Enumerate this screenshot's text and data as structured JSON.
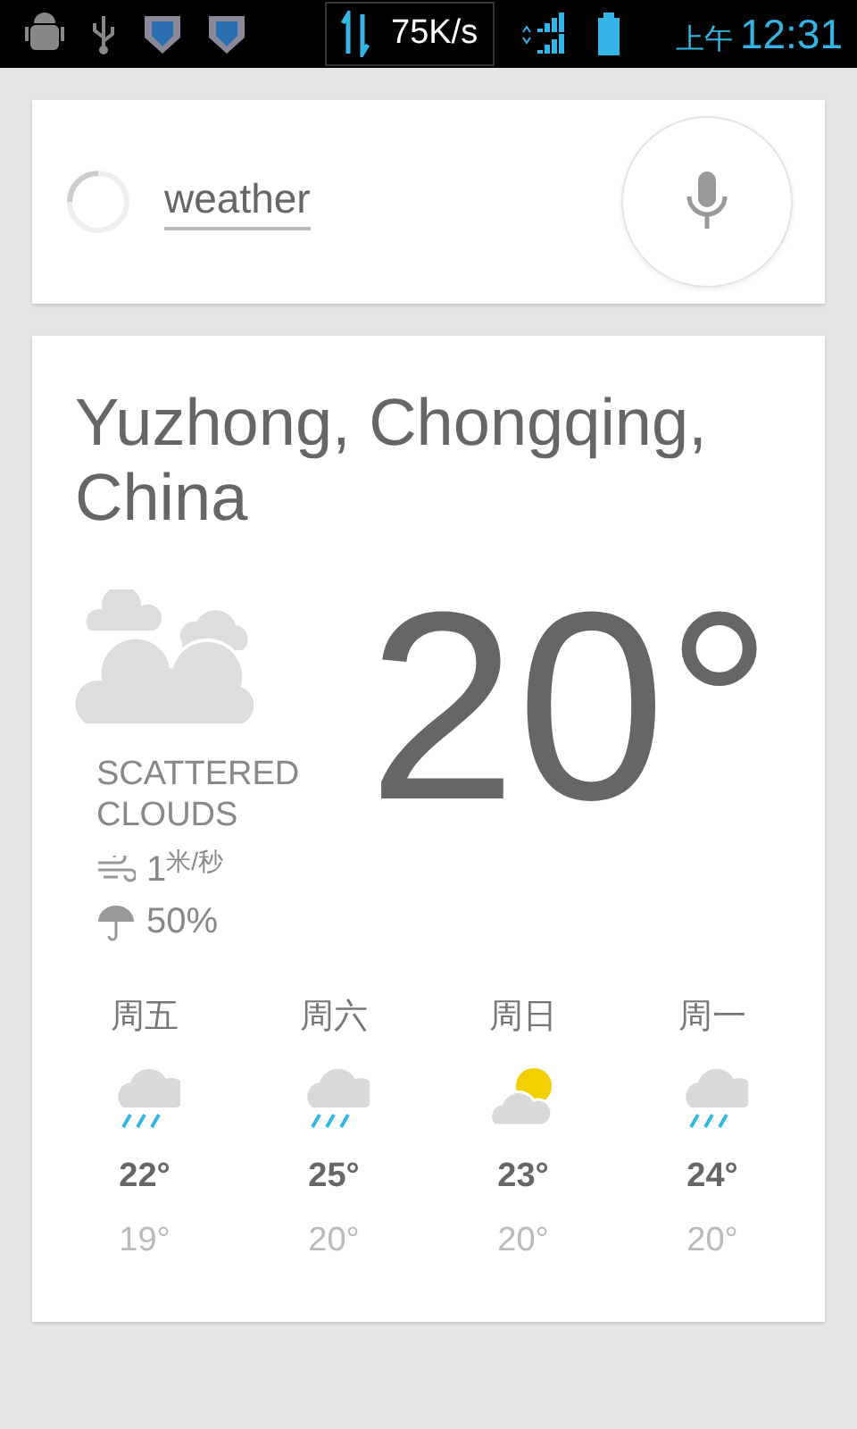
{
  "status_bar": {
    "speed": "75K/s",
    "period": "上午",
    "time": "12:31"
  },
  "search": {
    "query": "weather"
  },
  "weather": {
    "location": "Yuzhong, Chongqing, China",
    "temperature": "20°",
    "condition": "SCATTERED CLOUDS",
    "wind": "1$^{米/秒}$",
    "precipitation": "50%",
    "forecast": [
      {
        "day": "周五",
        "kind": "rain",
        "high": "22°",
        "low": "19°"
      },
      {
        "day": "周六",
        "kind": "rain",
        "high": "25°",
        "low": "20°"
      },
      {
        "day": "周日",
        "kind": "partly_cloudy",
        "high": "23°",
        "low": "20°"
      },
      {
        "day": "周一",
        "kind": "rain",
        "high": "24°",
        "low": "20°"
      }
    ]
  }
}
